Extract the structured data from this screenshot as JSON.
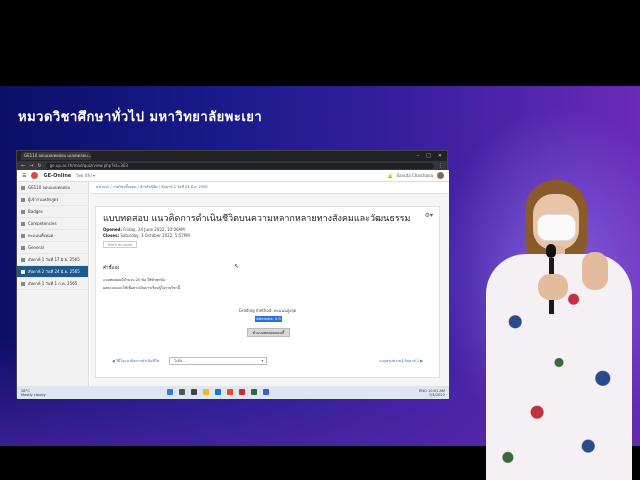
{
  "slide": {
    "banner": "หมวดวิชาศึกษาทั่วไป มหาวิทยาลัยพะเยา"
  },
  "browser": {
    "tab_title": "GE110 จอบแบบทดสอบ แบบทดสอบ...",
    "address": "ge.up.ac.th/mod/quiz/view.php?id=303"
  },
  "app": {
    "brand": "GE-Online",
    "language": "ไทย (th) ▾",
    "user_name": "Sanuta Chaichana"
  },
  "sidebar": {
    "items": [
      {
        "label": "GE110 จอบแบบทดสอบ"
      },
      {
        "label": "ผู้เข้าร่วมหลักสูตร"
      },
      {
        "label": "Badges"
      },
      {
        "label": "Competencies"
      },
      {
        "label": "คะแนนทั้งหมด"
      },
      {
        "label": "General"
      },
      {
        "label": "สัปดาห์ 1 วันที่ 17 มิ.ย. 2565"
      },
      {
        "label": "สัปดาห์ 2 วันที่ 24 มิ.ย. 2565"
      },
      {
        "label": "สัปดาห์ 1 วันที่ 1 ก.ค. 2565"
      }
    ],
    "active_index": 7
  },
  "breadcrumb": "หน้าแรก / รายวิชาทั้งหมด / สำหรับนิสิต / สัปดาห์ 2 วันที่ 24 มิ.ย. 2565",
  "quiz": {
    "title": "แบบทดสอบ แนวคิดการดำเนินชีวิตบนความหลากหลายทางสังคมและวัฒนธรรม",
    "opened_label": "Opened:",
    "opened_value": "Friday, 24 June 2022, 10:00AM",
    "closes_label": "Closes:",
    "closes_value": "Saturday, 1 October 2022, 5:57PM",
    "mark_done": "Mark as done",
    "section_heading": "คำชี้แจง",
    "instruction_1": "แบบทดสอบมีจำนวน 20 ข้อ ให้ทำทุกข้อ",
    "instruction_2": "ผลคะแนนจะใช้เพื่อประเมินการเรียนรู้ในรายวิชานี้",
    "grading_method": "Grading method: คะแนนสูงสุด",
    "attempts_allowed": "Attempts: 0/3",
    "attempt_button": "ทำแบบทดสอบตอนนี้",
    "prev_link": "◀ วิดีโอแนวคิดการดำเนินชีวิต",
    "jump_to": "ไปยัง...",
    "next_link": "แบบสรุปความรู้ สัปดาห์ 2 ▶"
  },
  "taskbar": {
    "weather_temp": "28°C",
    "weather_text": "Mostly cloudy",
    "lang": "ENG",
    "time": "10:01 AM",
    "date": "7/4/2022"
  },
  "colors": {
    "slide_bg_start": "#0b0f66",
    "slide_bg_end": "#6a2bb8",
    "active_sidebar": "#1d5b8f",
    "brand_logo": "#e0483c"
  }
}
